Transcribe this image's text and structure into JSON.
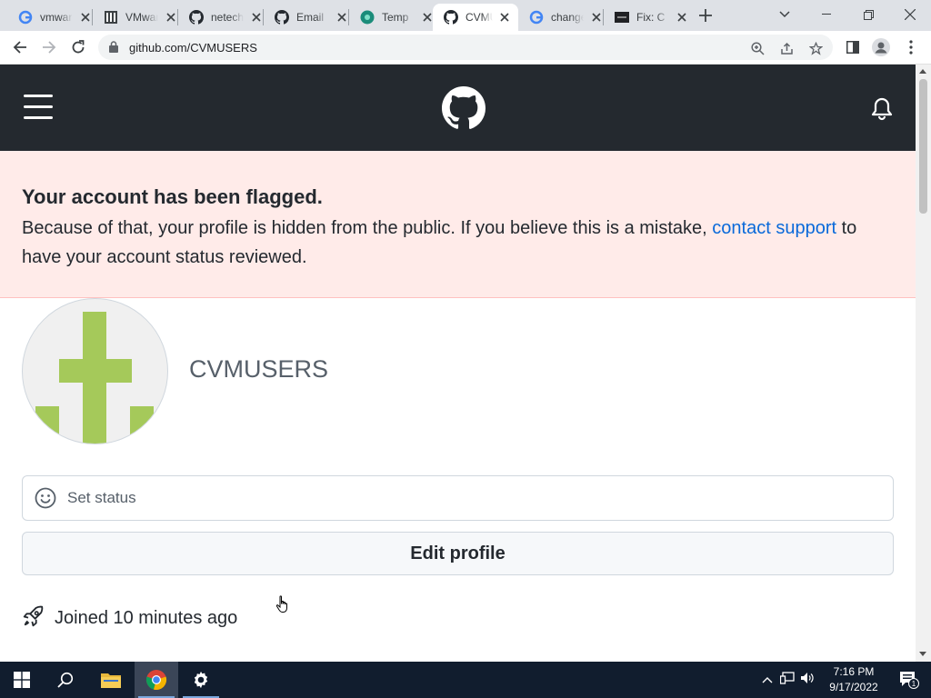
{
  "browser": {
    "tabs": [
      {
        "title": "vmware",
        "icon": "google-icon"
      },
      {
        "title": "VMware",
        "icon": "vmware-icon"
      },
      {
        "title": "netech",
        "icon": "github-icon"
      },
      {
        "title": "Email",
        "icon": "github-icon"
      },
      {
        "title": "Temp",
        "icon": "temp-mail-icon"
      },
      {
        "title": "CVMUSERS",
        "icon": "github-icon",
        "active": true
      },
      {
        "title": "change",
        "icon": "google-icon"
      },
      {
        "title": "Fix: C",
        "icon": "site-icon"
      }
    ],
    "url": "github.com/CVMUSERS"
  },
  "page": {
    "flash": {
      "title": "Your account has been flagged.",
      "body_before": "Because of that, your profile is hidden from the public. If you believe this is a mistake, ",
      "link": "contact support",
      "body_after": " to have your account status reviewed."
    },
    "profile": {
      "username": "CVMUSERS",
      "status_placeholder": "Set status",
      "edit_button": "Edit profile",
      "joined": "Joined 10 minutes ago"
    }
  },
  "taskbar": {
    "time": "7:16 PM",
    "date": "9/17/2022",
    "notification_count": "1"
  },
  "colors": {
    "header_bg": "#24292f",
    "flash_bg": "#ffebe9",
    "link": "#0969da",
    "avatar_green": "#a5c95a"
  }
}
